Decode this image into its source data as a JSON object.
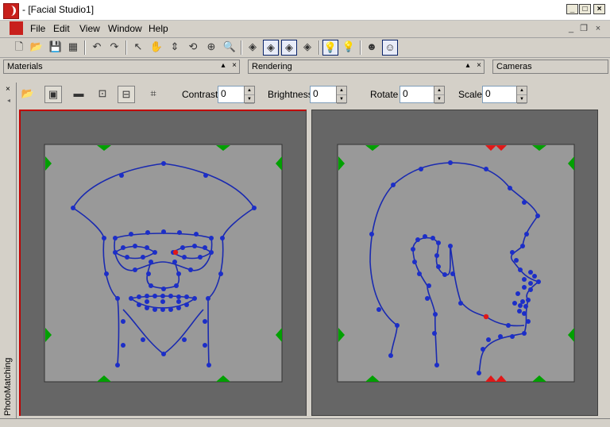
{
  "window": {
    "title": "- [Facial Studio1]",
    "minimize_glyph": "_",
    "maximize_glyph": "□",
    "close_glyph": "×"
  },
  "menu": {
    "items": [
      "File",
      "Edit",
      "View",
      "Window",
      "Help"
    ],
    "mdi_minimize": "_",
    "mdi_restore": "❐",
    "mdi_close": "×"
  },
  "toolbar": {
    "icons": [
      "new-icon",
      "open-icon",
      "save-icon",
      "save-all-icon",
      "undo-icon",
      "redo-icon",
      "select-icon",
      "pan-hand-icon",
      "move-vertical-icon",
      "rotate-icon",
      "orbit-icon",
      "zoom-icon",
      "view-front-icon",
      "view-side-icon",
      "view-both-icon",
      "view-quad-icon",
      "light-on-icon",
      "light-off-icon",
      "head-icon",
      "head-toggle-icon"
    ],
    "glyphs": [
      "🗋",
      "📂",
      "💾",
      "▦",
      "↶",
      "↷",
      "↖",
      "✋",
      "⇕",
      "⟲",
      "⊕",
      "🔍",
      "◈",
      "◈",
      "◈",
      "◈",
      "💡",
      "💡",
      "☻",
      "☺"
    ]
  },
  "panels": {
    "materials": "Materials",
    "rendering": "Rendering",
    "cameras": "Cameras",
    "pin_glyph": "▴",
    "close_glyph": "×"
  },
  "side_strip": {
    "close_glyph": "×",
    "arrow_glyph": "◂",
    "label": "PhotoMatching"
  },
  "photomatching": {
    "tool_glyphs": [
      "📂",
      "▣",
      "▬",
      "⊡",
      "⊟",
      "⌗"
    ],
    "contrast_label": "Contrast",
    "contrast_value": "0",
    "brightness_label": "Brightness",
    "brightness_value": "0",
    "rotate_label": "Rotate",
    "rotate_value": "0",
    "scale_label": "Scale",
    "scale_value": "0",
    "up_glyph": "▲",
    "down_glyph": "▼"
  },
  "colors": {
    "viewport_bg": "#666666",
    "photo_bg": "#999999",
    "curve": "#1a2ab0",
    "point": "#1c2ec8",
    "selected_point": "#e01818",
    "handle": "#00a000",
    "handle_active": "#e01818",
    "active_border": "#c00000"
  }
}
